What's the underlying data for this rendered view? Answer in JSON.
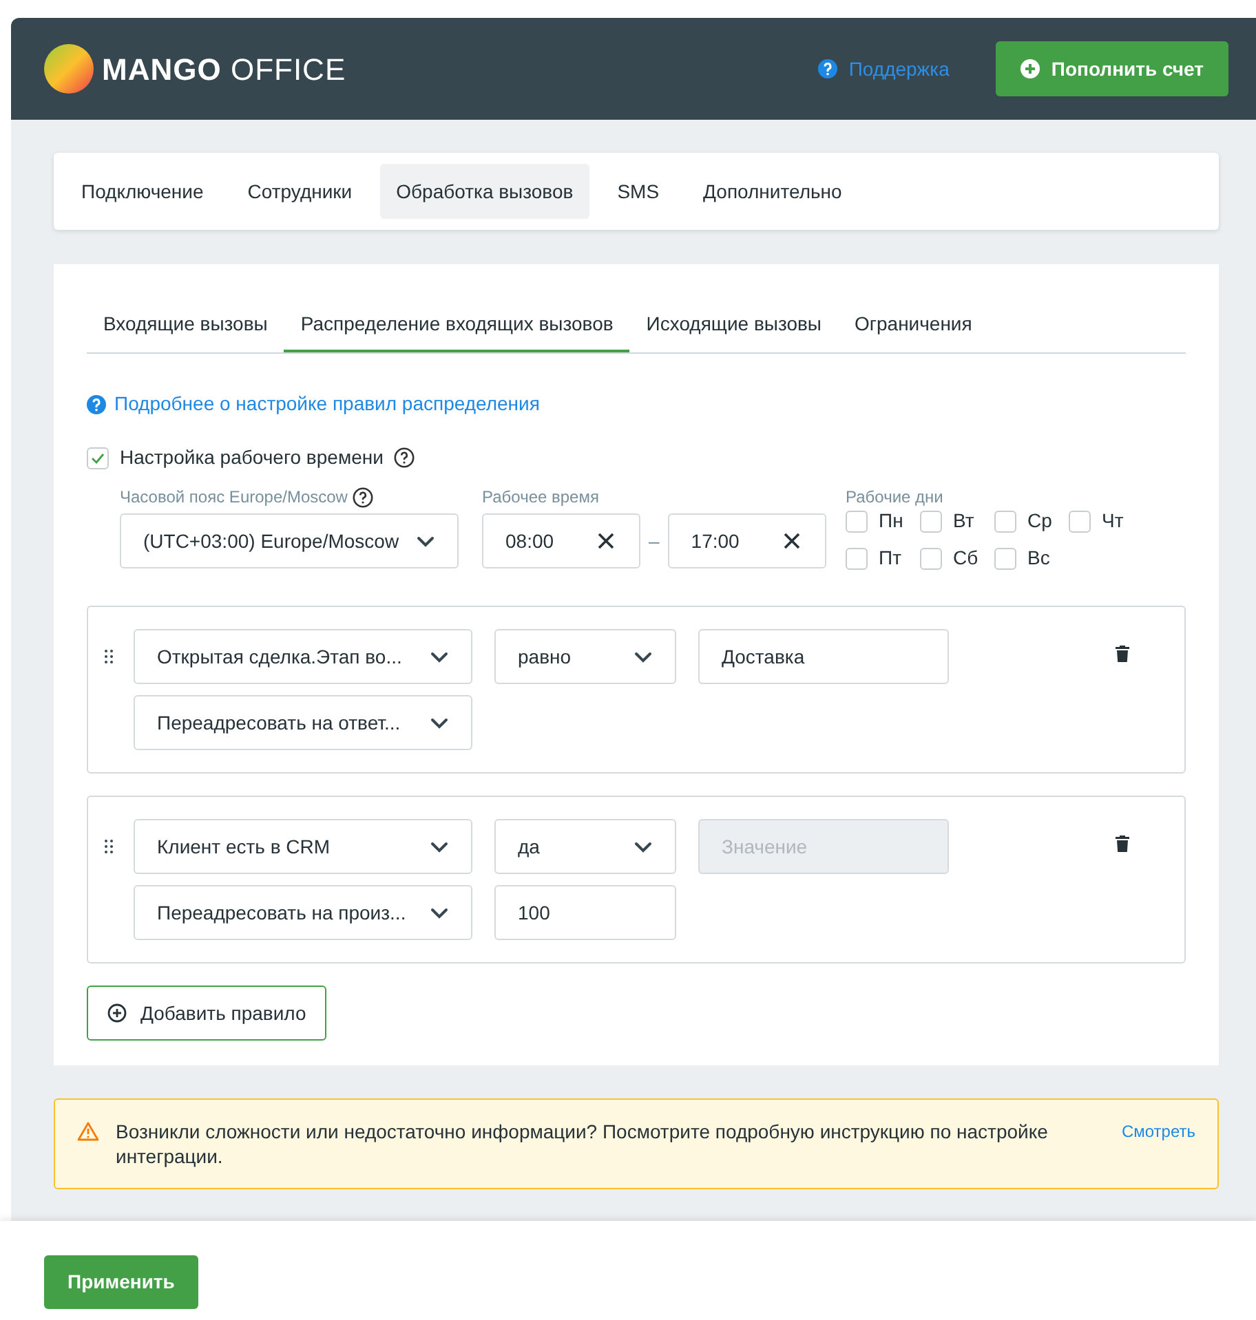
{
  "header": {
    "logo_bold": "MANGO",
    "logo_light": "OFFICE",
    "support": "Поддержка",
    "topup_button": "Пополнить счет"
  },
  "main_tabs": [
    {
      "label": "Подключение",
      "selected": false
    },
    {
      "label": "Сотрудники",
      "selected": false
    },
    {
      "label": "Обработка вызовов",
      "selected": true
    },
    {
      "label": "SMS",
      "selected": false
    },
    {
      "label": "Дополнительно",
      "selected": false
    }
  ],
  "sub_tabs": [
    {
      "label": "Входящие вызовы",
      "selected": false
    },
    {
      "label": "Распределение входящих вызовов",
      "selected": true
    },
    {
      "label": "Исходящие вызовы",
      "selected": false
    },
    {
      "label": "Ограничения",
      "selected": false
    }
  ],
  "help_link": "Подробнее о настройке правил распределения",
  "work_time": {
    "label": "Настройка рабочего времени",
    "checked": true,
    "timezone_label": "Часовой пояс Europe/Moscow",
    "timezone": "(UTC+03:00) Europe/Moscow",
    "hours_label": "Рабочее время",
    "from": "08:00",
    "dash": "–",
    "to": "17:00",
    "days_label": "Рабочие дни",
    "days": [
      {
        "label": "Пн",
        "checked": false
      },
      {
        "label": "Вт",
        "checked": false
      },
      {
        "label": "Ср",
        "checked": false
      },
      {
        "label": "Чт",
        "checked": false
      },
      {
        "label": "Пт",
        "checked": false
      },
      {
        "label": "Сб",
        "checked": false
      },
      {
        "label": "Вс",
        "checked": false
      }
    ]
  },
  "rules": [
    {
      "rows": [
        [
          {
            "kind": "select",
            "value": "Открытая сделка.Этап во..."
          },
          {
            "kind": "select",
            "value": "равно"
          },
          {
            "kind": "input",
            "value": "Доставка",
            "disabled": false
          }
        ],
        [
          {
            "kind": "select",
            "value": "Переадресовать на ответ..."
          }
        ]
      ]
    },
    {
      "rows": [
        [
          {
            "kind": "select",
            "value": "Клиент есть в CRM"
          },
          {
            "kind": "select",
            "value": "да"
          },
          {
            "kind": "input",
            "placeholder": "Значение",
            "disabled": true
          }
        ],
        [
          {
            "kind": "select",
            "value": "Переадресовать на произ..."
          },
          {
            "kind": "input",
            "value": "100",
            "disabled": false
          }
        ]
      ]
    }
  ],
  "add_rule_button": "Добавить правило",
  "notice": {
    "text": "Возникли сложности или недостаточно информации? Посмотрите подробную инструкцию по настройке интеграции.",
    "link": "Смотреть"
  },
  "apply_button": "Применить"
}
